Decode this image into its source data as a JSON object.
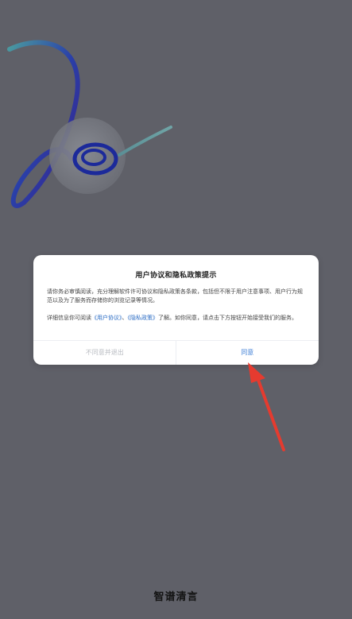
{
  "dialog": {
    "title": "用户协议和隐私政策提示",
    "body_p1": "请你务必审慎阅读，充分理解软件许可协议和隐私政策各条款，包括但不限于用户注意事项、用户行为规范以及为了服务而存储你的浏览记录等情况。",
    "body_p2_prefix": "详细信息你可阅读",
    "link_user_agreement": "《用户协议》",
    "body_p2_sep": "、",
    "link_privacy_policy": "《隐私政策》",
    "body_p2_suffix": "了解。如你同意，请点击下方按钮开始接受我们的服务。",
    "decline_label": "不同意并退出",
    "agree_label": "同意"
  },
  "brand": {
    "name": "智谱清言"
  },
  "colors": {
    "background": "#5f6068",
    "link": "#2b6cc4",
    "agree": "#3c7ed6",
    "arrow": "#e53b2f"
  }
}
